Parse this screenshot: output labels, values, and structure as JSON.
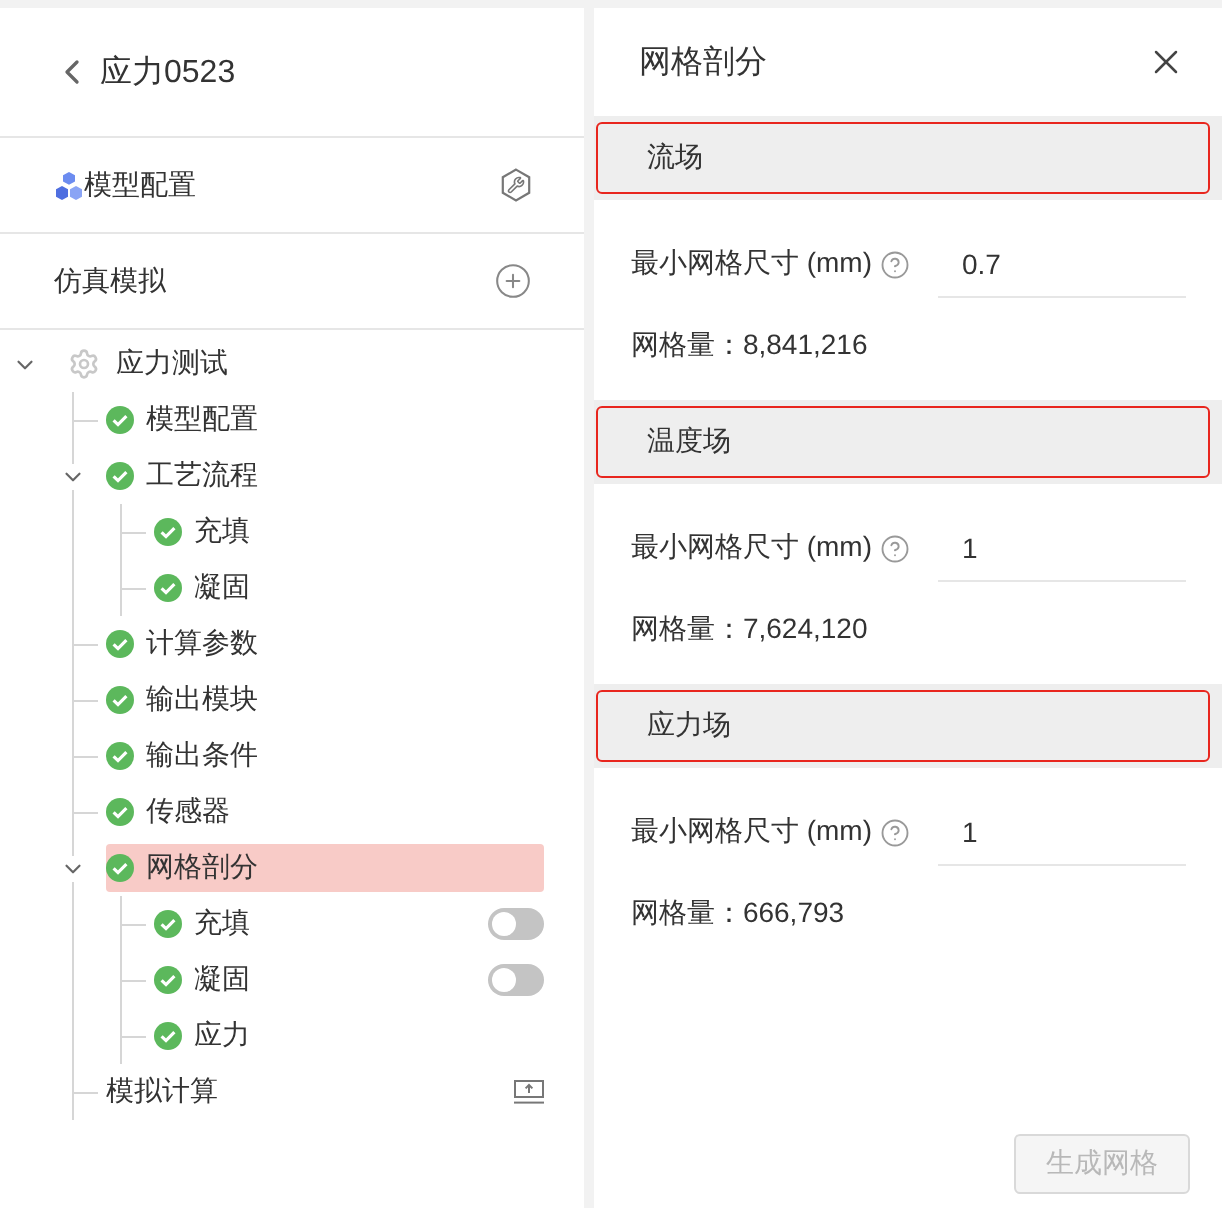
{
  "header": {
    "title": "应力0523"
  },
  "model_config": {
    "label": "模型配置"
  },
  "simulation": {
    "label": "仿真模拟"
  },
  "tree": {
    "label": "应力测试",
    "kind": "group",
    "expanded": true,
    "selected": false,
    "children": [
      {
        "label": "模型配置",
        "kind": "step",
        "selected": false
      },
      {
        "label": "工艺流程",
        "kind": "step",
        "expanded": true,
        "selected": false,
        "children": [
          {
            "label": "充填",
            "kind": "step",
            "selected": false
          },
          {
            "label": "凝固",
            "kind": "step",
            "selected": false
          }
        ]
      },
      {
        "label": "计算参数",
        "kind": "step",
        "selected": false
      },
      {
        "label": "输出模块",
        "kind": "step",
        "selected": false
      },
      {
        "label": "输出条件",
        "kind": "step",
        "selected": false
      },
      {
        "label": "传感器",
        "kind": "step",
        "selected": false
      },
      {
        "label": "网格剖分",
        "kind": "step",
        "expanded": true,
        "selected": true,
        "children": [
          {
            "label": "充填",
            "kind": "toggle_step",
            "on": false,
            "selected": false
          },
          {
            "label": "凝固",
            "kind": "toggle_step",
            "on": false,
            "selected": false
          },
          {
            "label": "应力",
            "kind": "step",
            "selected": false
          }
        ]
      },
      {
        "label": "模拟计算",
        "kind": "run",
        "selected": false
      }
    ]
  },
  "panel": {
    "title": "网格剖分",
    "sections": [
      {
        "title": "流场",
        "outlined": true,
        "size_label": "最小网格尺寸 (mm)",
        "size_value": "0.7",
        "count": "网格量：8,841,216"
      },
      {
        "title": "温度场",
        "outlined": true,
        "size_label": "最小网格尺寸 (mm)",
        "size_value": "1",
        "count": "网格量：7,624,120"
      },
      {
        "title": "应力场",
        "outlined": true,
        "size_label": "最小网格尺寸 (mm)",
        "size_value": "1",
        "count": "网格量：666,793"
      }
    ],
    "generate_button": {
      "label": "生成网格",
      "disabled": true
    }
  }
}
